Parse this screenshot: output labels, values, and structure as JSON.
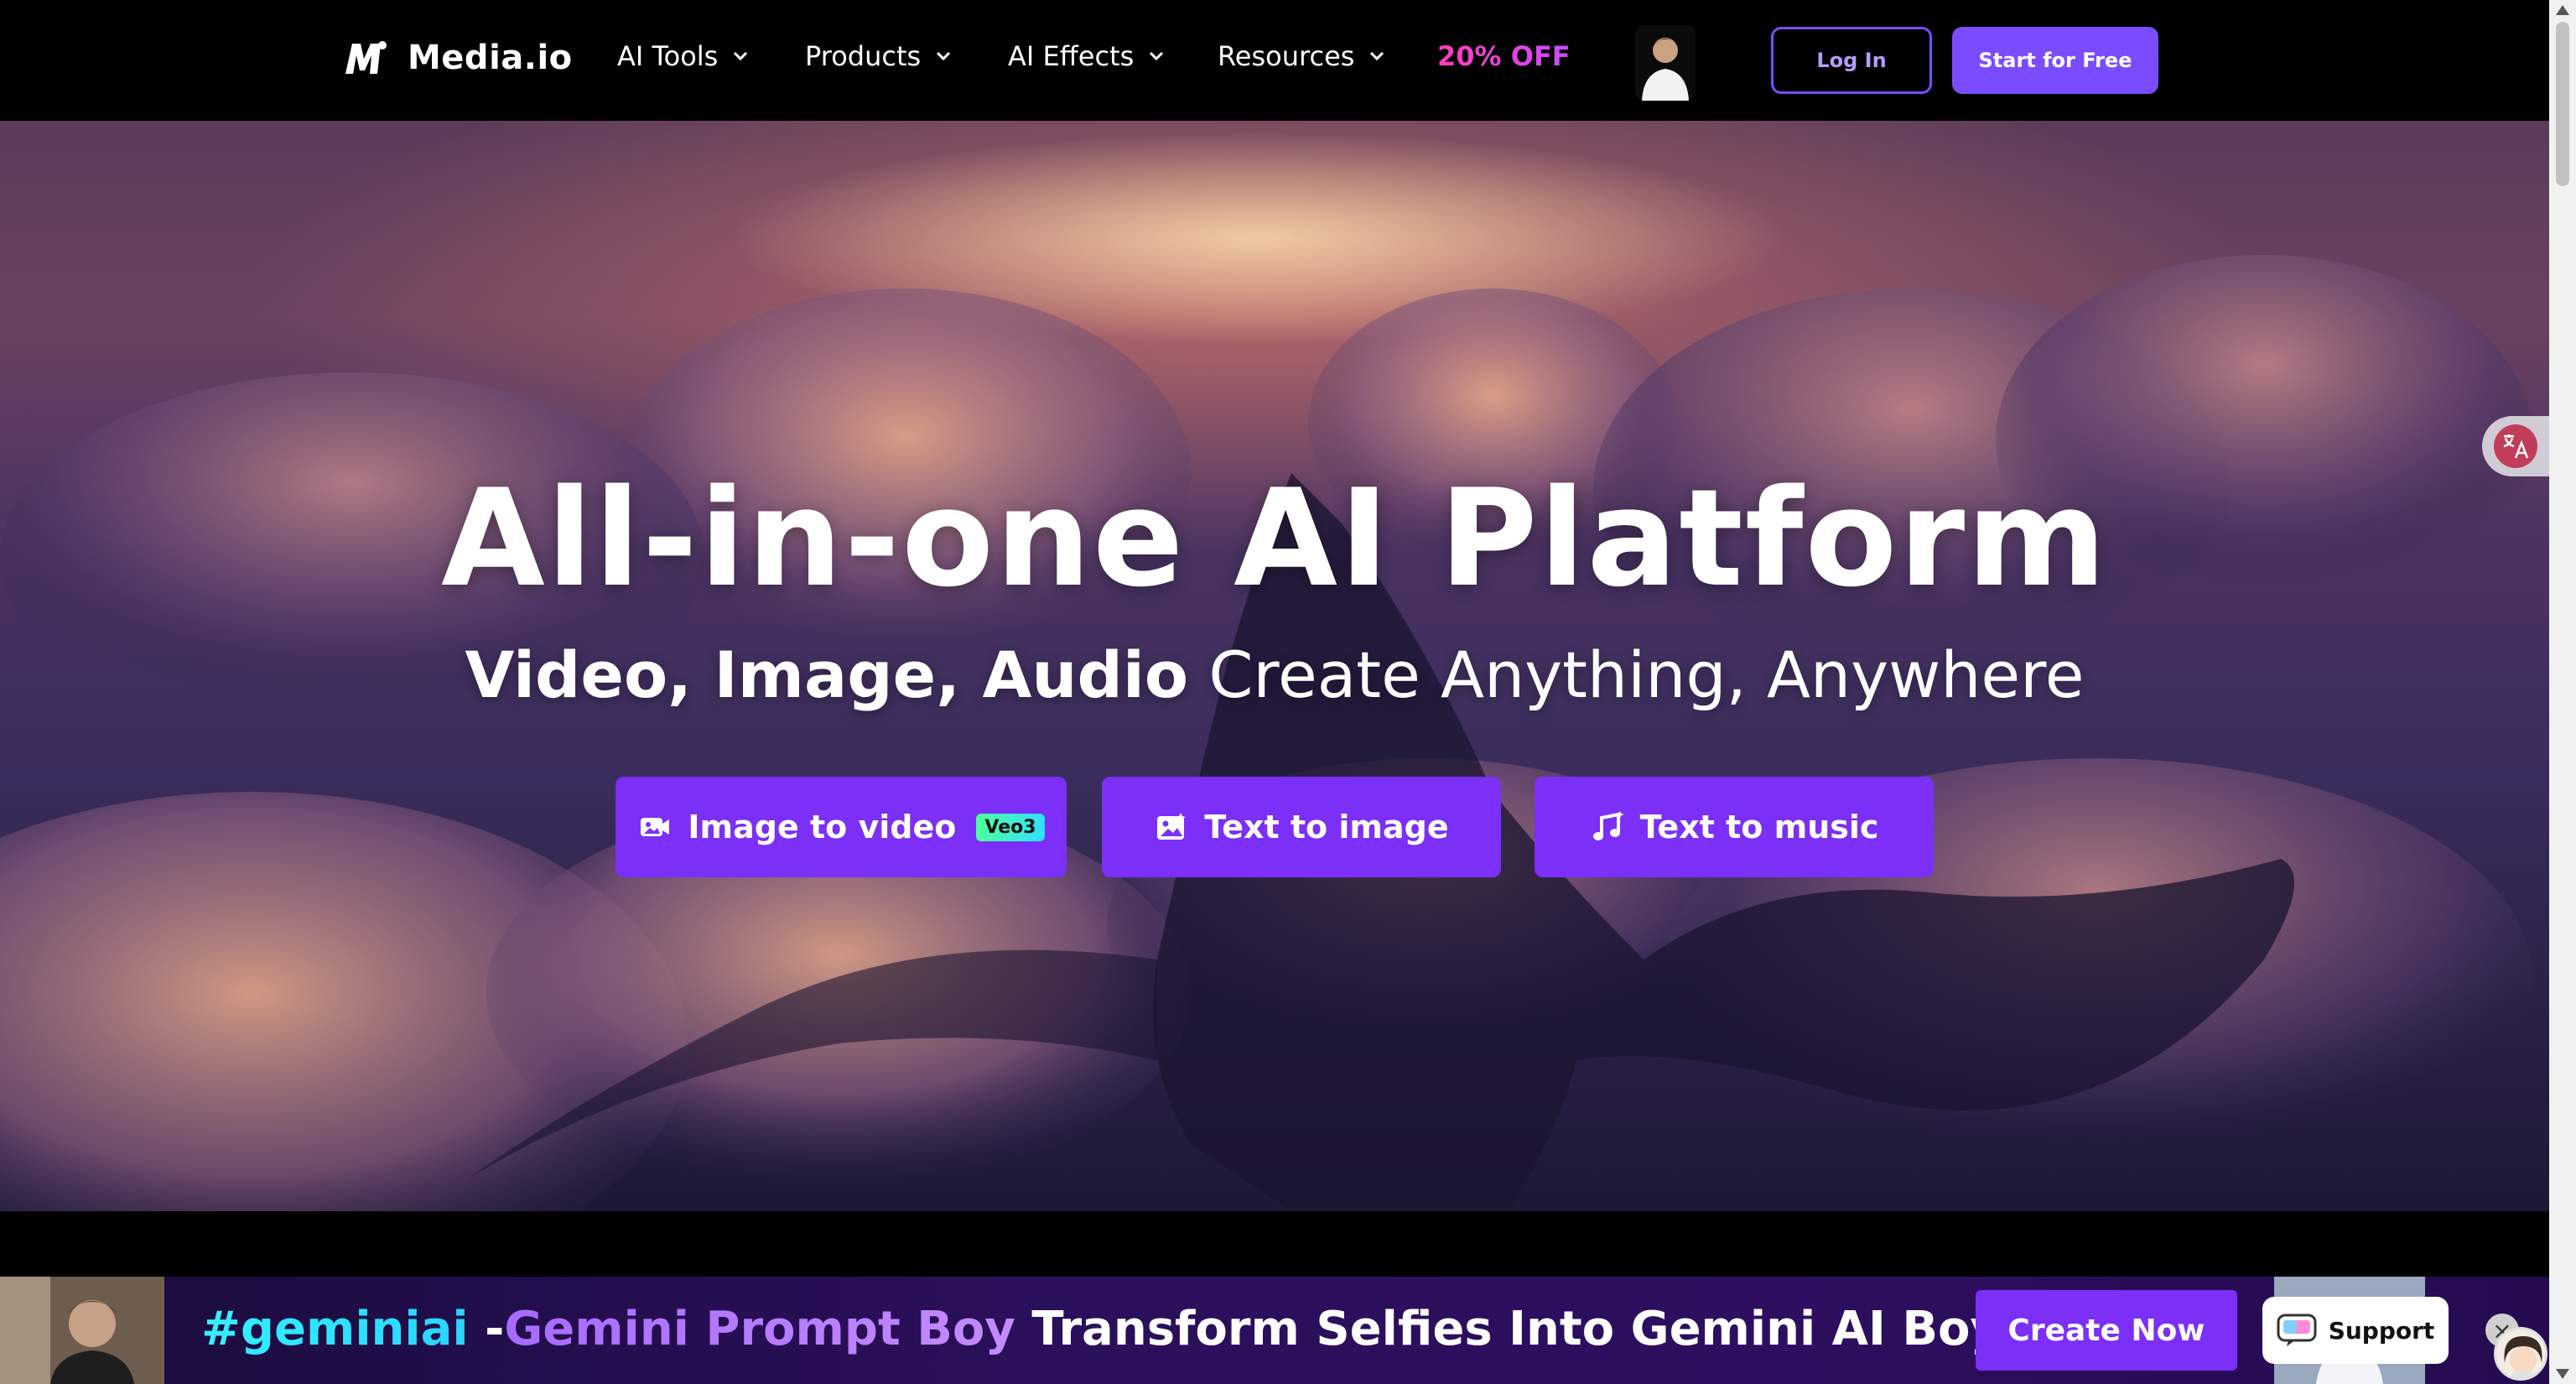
{
  "brand": {
    "name": "Media.io"
  },
  "nav": {
    "items": [
      {
        "label": "AI Tools"
      },
      {
        "label": "Products"
      },
      {
        "label": "AI Effects"
      },
      {
        "label": "Resources"
      }
    ],
    "promo": "20% OFF",
    "login": "Log In",
    "start": "Start for Free"
  },
  "hero": {
    "title": "All-in-one AI Platform",
    "subtitle_bold": "Video, Image, Audio",
    "subtitle_light": "Create Anything, Anywhere",
    "ctas": [
      {
        "label": "Image to video",
        "badge": "Veo3",
        "icon": "image-to-video-icon"
      },
      {
        "label": "Text to image",
        "icon": "image-icon"
      },
      {
        "label": "Text to music",
        "icon": "music-note-icon"
      }
    ]
  },
  "banner": {
    "tag": "#geminiai",
    "dash": "-",
    "product": "Gemini Prompt Boy",
    "headline": "Transform Selfies Into Gemini AI Boy Looks",
    "cta": "Create Now",
    "support": "Support"
  },
  "colors": {
    "accent": "#7b2ff7",
    "promo": "#e040fb",
    "login_border": "#7a4dff"
  }
}
